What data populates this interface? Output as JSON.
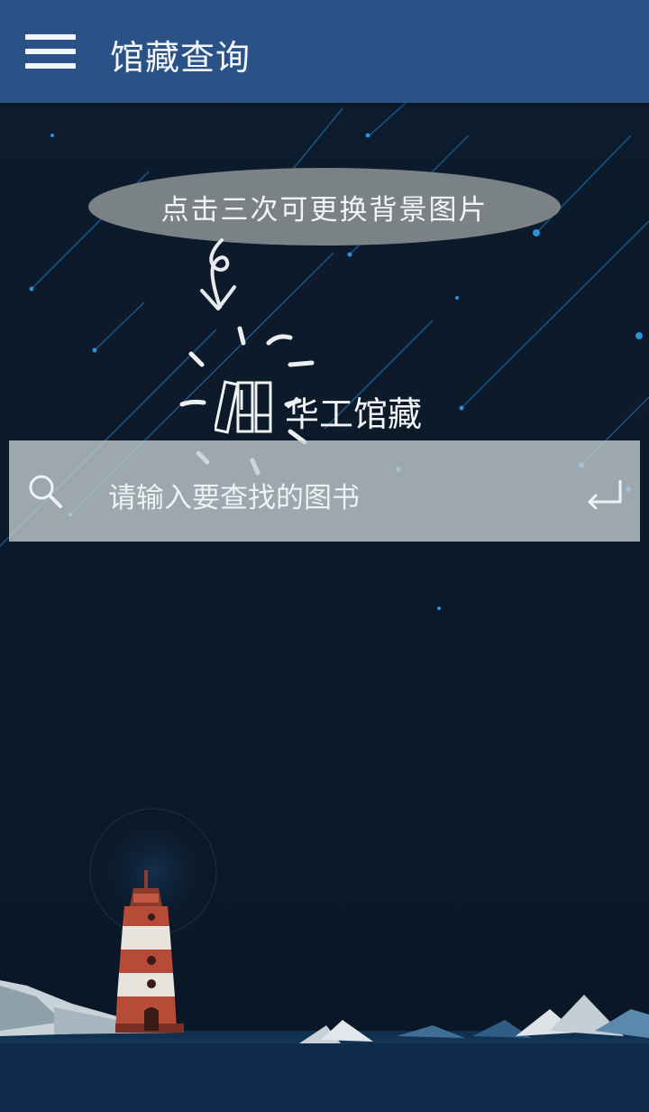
{
  "appbar": {
    "title": "馆藏查询",
    "menu_icon": "hamburger-menu-icon"
  },
  "hint": {
    "text": "点击三次可更换背景图片",
    "arrow_icon": "hand-drawn-arrow-icon"
  },
  "brand": {
    "label": "华工馆藏",
    "icon": "books-icon"
  },
  "search": {
    "placeholder": "请输入要查找的图书",
    "search_icon": "search-icon",
    "submit_icon": "enter-return-icon"
  },
  "colors": {
    "appbar": "#2a5286",
    "background": "#0c1b2c",
    "hint_bubble": "#7b8286",
    "search_bar": "#c5cfd4",
    "meteor": "#2f8fd8"
  }
}
